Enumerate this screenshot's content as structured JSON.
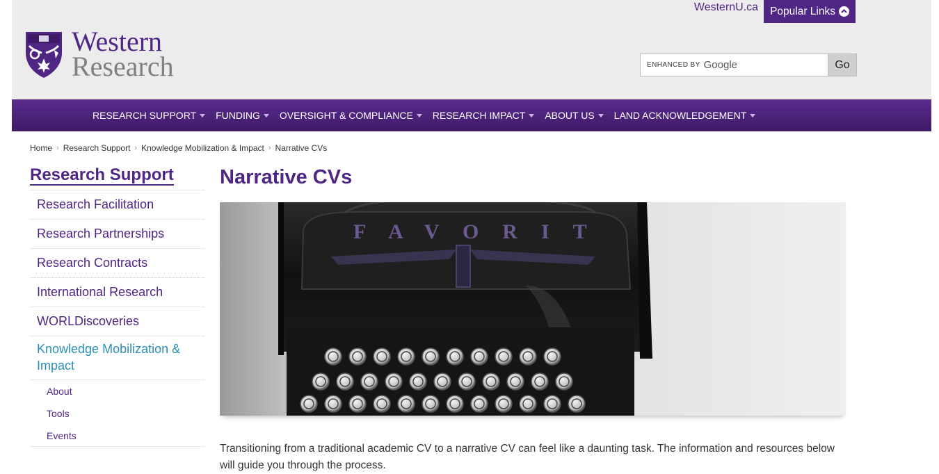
{
  "header": {
    "westernu_link": "WesternU.ca",
    "popular_links": "Popular Links",
    "logo_line1": "Western",
    "logo_line2": "Research",
    "search_prefix": "ENHANCED BY",
    "search_brand": "Google",
    "go_label": "Go"
  },
  "nav": {
    "items": [
      {
        "label": "RESEARCH SUPPORT"
      },
      {
        "label": "FUNDING"
      },
      {
        "label": "OVERSIGHT & COMPLIANCE"
      },
      {
        "label": "RESEARCH IMPACT"
      },
      {
        "label": "ABOUT US"
      },
      {
        "label": "LAND ACKNOWLEDGEMENT"
      }
    ]
  },
  "breadcrumb": [
    "Home",
    "Research Support",
    "Knowledge Mobilization & Impact",
    "Narrative CVs"
  ],
  "sidebar": {
    "title": "Research Support",
    "items": [
      {
        "label": "Research Facilitation"
      },
      {
        "label": "Research Partnerships"
      },
      {
        "label": "Research Contracts"
      },
      {
        "label": "International Research"
      },
      {
        "label": "WORLDiscoveries"
      },
      {
        "label": "Knowledge Mobilization & Impact"
      }
    ],
    "subitems": [
      {
        "label": "About"
      },
      {
        "label": "Tools"
      },
      {
        "label": "Events"
      }
    ]
  },
  "main": {
    "title": "Narrative CVs",
    "typewriter_brand": "FAVORIT",
    "intro": "Transitioning from a traditional academic CV to a narrative CV can feel like a daunting task. The information and resources below will guide you through the process."
  },
  "colors": {
    "brand_purple": "#4f2683",
    "active_blue": "#2a8fb6",
    "header_bg": "#ececec"
  }
}
